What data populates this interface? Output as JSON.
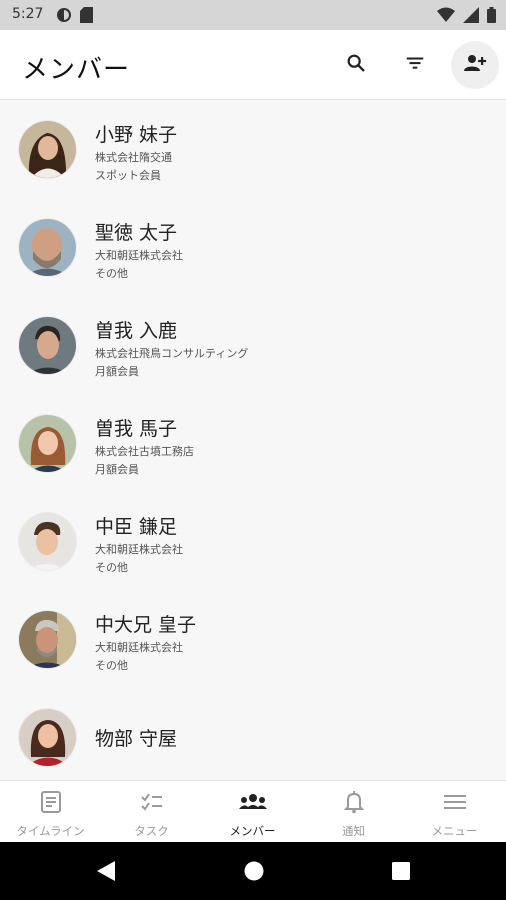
{
  "status_bar": {
    "time": "5:27",
    "icons": [
      "sync-icon",
      "sd-card-icon",
      "wifi-icon",
      "signal-icon",
      "battery-icon"
    ]
  },
  "app_bar": {
    "title": "メンバー",
    "actions": [
      "search-icon",
      "filter-icon",
      "add-user-icon"
    ]
  },
  "members": [
    {
      "name": "小野 妹子",
      "company": "株式会社隋交通",
      "type": "スポット会員"
    },
    {
      "name": "聖徳 太子",
      "company": "大和朝廷株式会社",
      "type": "その他"
    },
    {
      "name": "曽我 入鹿",
      "company": "株式会社飛鳥コンサルティング",
      "type": "月額会員"
    },
    {
      "name": "曽我 馬子",
      "company": "株式会社古墳工務店",
      "type": "月額会員"
    },
    {
      "name": "中臣 鎌足",
      "company": "大和朝廷株式会社",
      "type": "その他"
    },
    {
      "name": "中大兄 皇子",
      "company": "大和朝廷株式会社",
      "type": "その他"
    },
    {
      "name": "物部 守屋",
      "company": "",
      "type": ""
    }
  ],
  "bottom_nav": {
    "items": [
      {
        "label": "タイムライン",
        "icon": "timeline-icon",
        "active": false
      },
      {
        "label": "タスク",
        "icon": "task-checklist-icon",
        "active": false
      },
      {
        "label": "メンバー",
        "icon": "members-icon",
        "active": true
      },
      {
        "label": "通知",
        "icon": "bell-icon",
        "active": false
      },
      {
        "label": "メニュー",
        "icon": "menu-icon",
        "active": false
      }
    ]
  },
  "colors": {
    "status_bar": "#d6d6d6",
    "app_bar": "#ffffff",
    "list_background": "#f7f7f7",
    "active_tab": "#222222",
    "inactive_tab": "#9a9a9a"
  }
}
